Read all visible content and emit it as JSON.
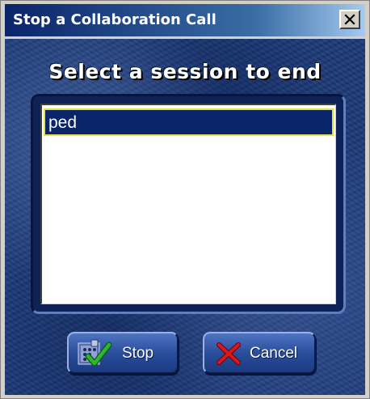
{
  "window": {
    "title": "Stop a Collaboration Call",
    "close_glyph": "close-icon"
  },
  "dialog": {
    "heading": "Select a session to end"
  },
  "sessions": {
    "items": [
      "ped"
    ],
    "selected": "ped"
  },
  "buttons": {
    "stop_label": "Stop",
    "stop_icon": "stop-session-icon",
    "cancel_label": "Cancel",
    "cancel_icon": "cancel-x-icon"
  },
  "colors": {
    "title_bar": "#0a246a",
    "panel": "#1c3a78",
    "selection": "#0a246a",
    "selection_border": "#e8e04a",
    "cancel_x": "#d8181c",
    "check": "#2fb52f"
  }
}
